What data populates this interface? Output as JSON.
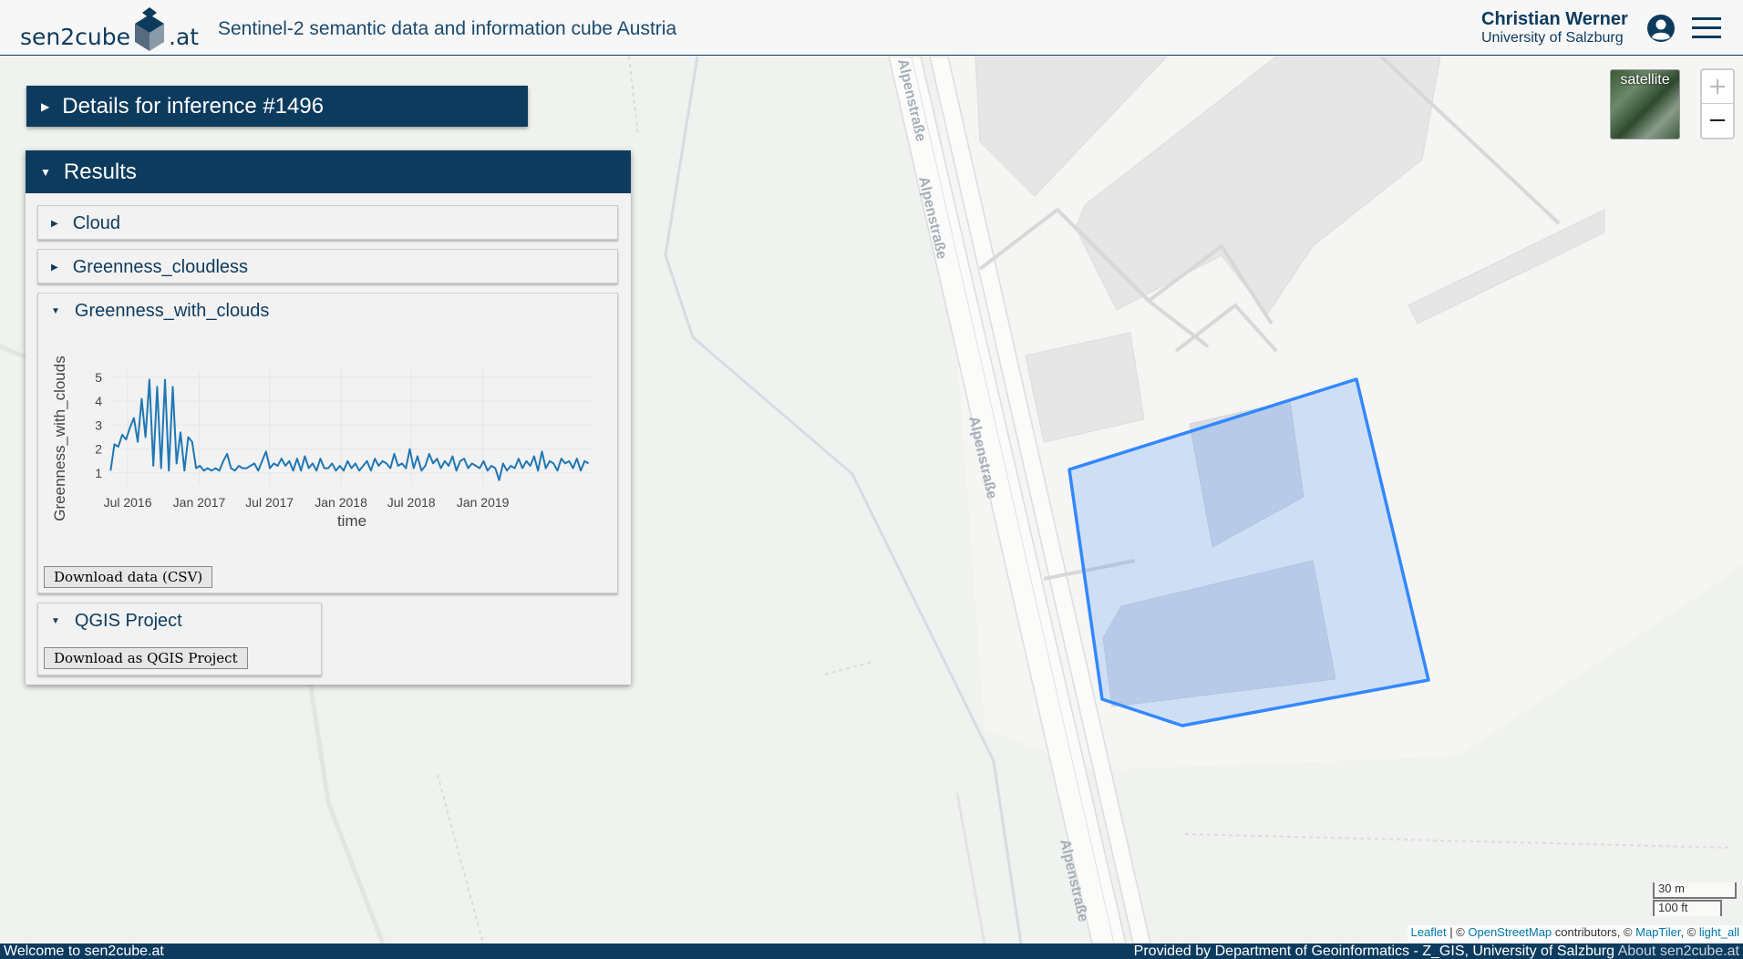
{
  "header": {
    "logo_prefix": "sen2cube",
    "logo_suffix": ".at",
    "title": "Sentinel-2 semantic data and information cube Austria",
    "user_name": "Christian Werner",
    "user_org": "University of Salzburg",
    "user_icon": "user-circle-icon",
    "menu_icon": "hamburger-menu-icon"
  },
  "details_panel": {
    "title": "Details for inference #1496",
    "expanded": false
  },
  "results_panel": {
    "title": "Results",
    "expanded": true,
    "sections": [
      {
        "title": "Cloud",
        "expanded": false
      },
      {
        "title": "Greenness_cloudless",
        "expanded": false
      },
      {
        "title": "Greenness_with_clouds",
        "expanded": true,
        "download_label": "Download data (CSV)"
      },
      {
        "title": "QGIS Project",
        "expanded": true,
        "download_label": "Download as QGIS Project"
      }
    ]
  },
  "chart_data": {
    "type": "line",
    "title": "",
    "xlabel": "time",
    "ylabel": "Greenness_with_clouds",
    "x_ticks": [
      "Jul 2016",
      "Jan 2017",
      "Jul 2017",
      "Jan 2018",
      "Jul 2018",
      "Jan 2019"
    ],
    "y_ticks": [
      1,
      2,
      3,
      4,
      5
    ],
    "ylim": [
      0.5,
      5.3
    ],
    "xlim": [
      "2016-05-15",
      "2019-10-15"
    ],
    "grid": true,
    "series": [
      {
        "color": "#1f77b4",
        "x": [
          "2016-05-18",
          "2016-05-28",
          "2016-06-07",
          "2016-06-17",
          "2016-06-27",
          "2016-07-07",
          "2016-07-17",
          "2016-07-27",
          "2016-08-06",
          "2016-08-16",
          "2016-08-26",
          "2016-09-05",
          "2016-09-15",
          "2016-09-25",
          "2016-10-05",
          "2016-10-15",
          "2016-10-25",
          "2016-11-04",
          "2016-11-14",
          "2016-11-24",
          "2016-12-04",
          "2016-12-14",
          "2016-12-24",
          "2017-01-03",
          "2017-01-13",
          "2017-01-23",
          "2017-02-02",
          "2017-02-12",
          "2017-02-22",
          "2017-03-04",
          "2017-03-14",
          "2017-03-24",
          "2017-04-03",
          "2017-04-13",
          "2017-04-23",
          "2017-05-03",
          "2017-05-13",
          "2017-05-23",
          "2017-06-02",
          "2017-06-12",
          "2017-06-22",
          "2017-07-02",
          "2017-07-12",
          "2017-07-22",
          "2017-08-01",
          "2017-08-11",
          "2017-08-21",
          "2017-08-31",
          "2017-09-10",
          "2017-09-20",
          "2017-09-30",
          "2017-10-10",
          "2017-10-20",
          "2017-10-30",
          "2017-11-09",
          "2017-11-19",
          "2017-11-29",
          "2017-12-09",
          "2017-12-19",
          "2017-12-29",
          "2018-01-08",
          "2018-01-18",
          "2018-01-28",
          "2018-02-07",
          "2018-02-17",
          "2018-02-27",
          "2018-03-09",
          "2018-03-19",
          "2018-03-29",
          "2018-04-08",
          "2018-04-18",
          "2018-04-28",
          "2018-05-08",
          "2018-05-18",
          "2018-05-28",
          "2018-06-07",
          "2018-06-17",
          "2018-06-27",
          "2018-07-07",
          "2018-07-17",
          "2018-07-27",
          "2018-08-06",
          "2018-08-16",
          "2018-08-26",
          "2018-09-05",
          "2018-09-15",
          "2018-09-25",
          "2018-10-05",
          "2018-10-15",
          "2018-10-25",
          "2018-11-04",
          "2018-11-14",
          "2018-11-24",
          "2018-12-04",
          "2018-12-14",
          "2018-12-24",
          "2019-01-03",
          "2019-01-13",
          "2019-01-23",
          "2019-02-02",
          "2019-02-12",
          "2019-02-22",
          "2019-03-04",
          "2019-03-14",
          "2019-03-24",
          "2019-04-03",
          "2019-04-13",
          "2019-04-23",
          "2019-05-03",
          "2019-05-13",
          "2019-05-23",
          "2019-06-02",
          "2019-06-12",
          "2019-06-22",
          "2019-07-02",
          "2019-07-12",
          "2019-07-22",
          "2019-08-01",
          "2019-08-11",
          "2019-08-21",
          "2019-08-31",
          "2019-09-10",
          "2019-09-20",
          "2019-09-30"
        ],
        "y": [
          1.1,
          2.2,
          2.1,
          2.6,
          2.4,
          2.9,
          3.3,
          2.3,
          4.1,
          2.5,
          4.9,
          1.3,
          4.6,
          1.2,
          4.9,
          1.1,
          4.6,
          1.4,
          2.7,
          1.1,
          2.5,
          2.3,
          1.2,
          1.3,
          1.1,
          1.2,
          1.1,
          1.2,
          1.1,
          1.5,
          1.8,
          1.2,
          1.1,
          1.3,
          1.2,
          1.2,
          1.3,
          1.4,
          1.1,
          1.5,
          1.9,
          1.2,
          1.4,
          1.3,
          1.6,
          1.3,
          1.5,
          1.1,
          1.6,
          1.1,
          1.7,
          1.2,
          1.4,
          1.1,
          1.6,
          1.2,
          1.2,
          1.4,
          1.1,
          1.3,
          1.1,
          1.5,
          1.2,
          1.4,
          1.1,
          1.3,
          1.5,
          1.1,
          1.6,
          1.3,
          1.5,
          1.4,
          1.2,
          1.8,
          1.3,
          1.4,
          1.2,
          2.0,
          1.2,
          1.7,
          1.1,
          1.3,
          1.8,
          1.4,
          1.6,
          1.2,
          1.5,
          1.3,
          1.7,
          1.1,
          1.5,
          1.6,
          1.2,
          1.4,
          1.3,
          1.2,
          1.5,
          1.1,
          1.3,
          1.2,
          0.7,
          1.4,
          1.1,
          1.3,
          1.2,
          1.6,
          1.2,
          1.5,
          1.3,
          1.7,
          1.1,
          1.9,
          1.2,
          1.5,
          1.4,
          1.1,
          1.6,
          1.4,
          1.5,
          1.2,
          1.6,
          1.1,
          1.5,
          1.4
        ]
      }
    ]
  },
  "map": {
    "layer_toggle_label": "satellite",
    "zoom_in": "+",
    "zoom_out": "−",
    "street_labels": [
      "Alpenstraße",
      "Alpenstraße",
      "Alpenstraße",
      "Alpenstraße"
    ],
    "scale_metric": "30 m",
    "scale_imperial": "100 ft",
    "polygon_color": "#3388ff",
    "attribution": {
      "leaflet": "Leaflet",
      "sep": " | © ",
      "osm": "OpenStreetMap",
      "contrib": " contributors, © ",
      "maptiler": "MapTiler",
      "sep2": ", © ",
      "carto": "light_all"
    }
  },
  "footer": {
    "left": "Welcome to sen2cube.at",
    "right": "Provided by Department of Geoinformatics - Z_GIS, University of Salzburg ",
    "about": "About sen2cube.at"
  },
  "colors": {
    "brand": "#0d3b5e",
    "accent": "#3388ff"
  }
}
